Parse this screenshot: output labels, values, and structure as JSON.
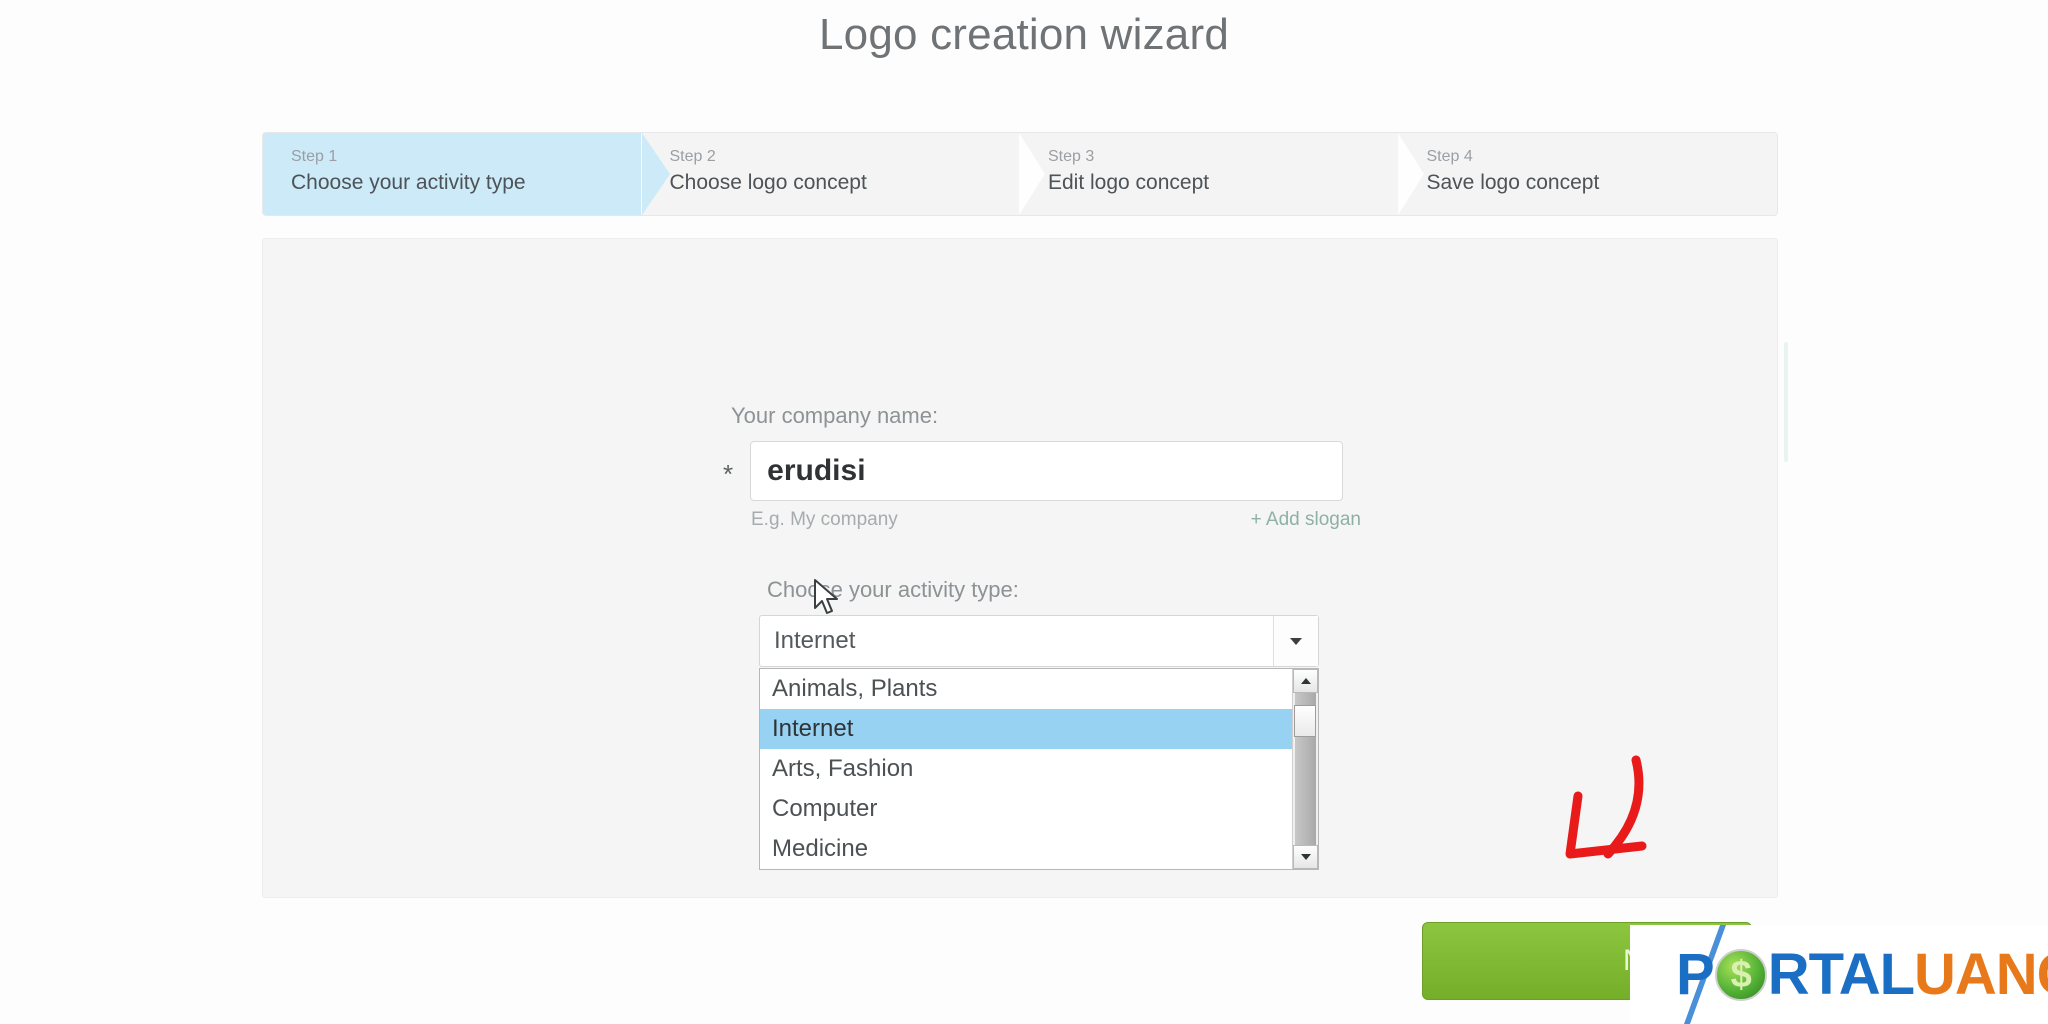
{
  "page": {
    "title": "Logo creation wizard"
  },
  "steps": [
    {
      "num": "Step 1",
      "label": "Choose your activity type",
      "active": true
    },
    {
      "num": "Step 2",
      "label": "Choose logo concept",
      "active": false
    },
    {
      "num": "Step 3",
      "label": "Edit logo concept",
      "active": false
    },
    {
      "num": "Step 4",
      "label": "Save logo concept",
      "active": false
    }
  ],
  "form": {
    "company_name_label": "Your company name:",
    "required_marker": "*",
    "company_name_value": "erudisi",
    "company_name_placeholder": "E.g. My company",
    "company_name_hint": "E.g. My company",
    "add_slogan_label": "+ Add slogan",
    "activity_label": "Choose your activity type:",
    "activity_selected": "Internet",
    "activity_options": [
      "Animals, Plants",
      "Internet",
      "Arts, Fashion",
      "Computer",
      "Medicine"
    ]
  },
  "footer": {
    "next_label": "NEXT"
  },
  "watermark": {
    "part_blue_1": "P",
    "coin_symbol": "$",
    "part_blue_2": "RTAL",
    "part_orange": "UANG"
  },
  "colors": {
    "step_active_bg": "#cceaf8",
    "step_bg": "#f4f4f4",
    "next_button": "#7bb32e",
    "option_selected": "#97d2f2",
    "annotation_arrow": "#e81a1a",
    "watermark_blue": "#1a6fc4",
    "watermark_orange": "#e8791a"
  }
}
